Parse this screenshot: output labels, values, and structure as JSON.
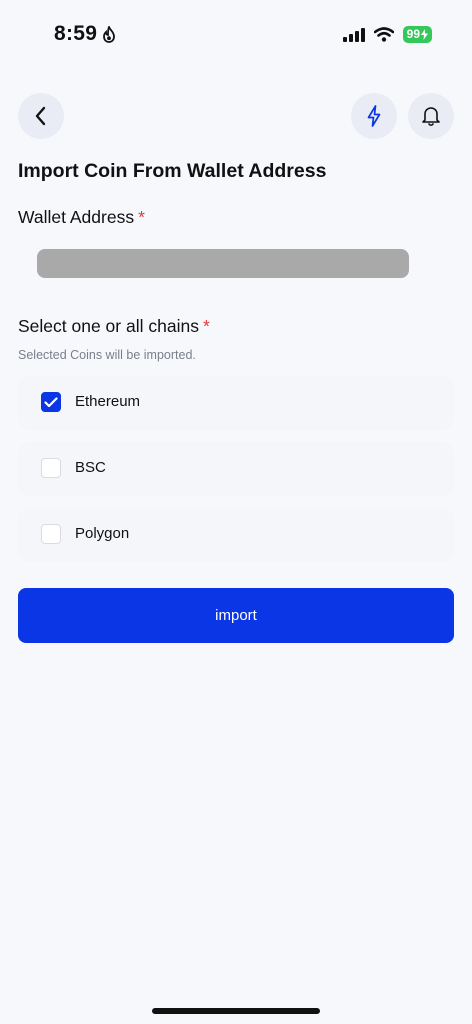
{
  "status_bar": {
    "time": "8:59",
    "battery": "99"
  },
  "header": {
    "title": "Import Coin From Wallet Address"
  },
  "wallet_field": {
    "label": "Wallet Address",
    "required_mark": "*",
    "value_redacted": true
  },
  "chains_field": {
    "label": "Select one or all chains",
    "required_mark": "*",
    "helper": "Selected Coins will be imported.",
    "options": [
      {
        "label": "Ethereum",
        "checked": true
      },
      {
        "label": "BSC",
        "checked": false
      },
      {
        "label": "Polygon",
        "checked": false
      }
    ]
  },
  "actions": {
    "import_label": "import"
  },
  "colors": {
    "accent": "#0a36e5",
    "required": "#e53935",
    "battery": "#34c759",
    "background": "#f7f8fc"
  },
  "icons": {
    "back": "chevron-left-icon",
    "bolt": "lightning-bolt-icon",
    "bell": "bell-icon",
    "flame": "flame-icon"
  }
}
